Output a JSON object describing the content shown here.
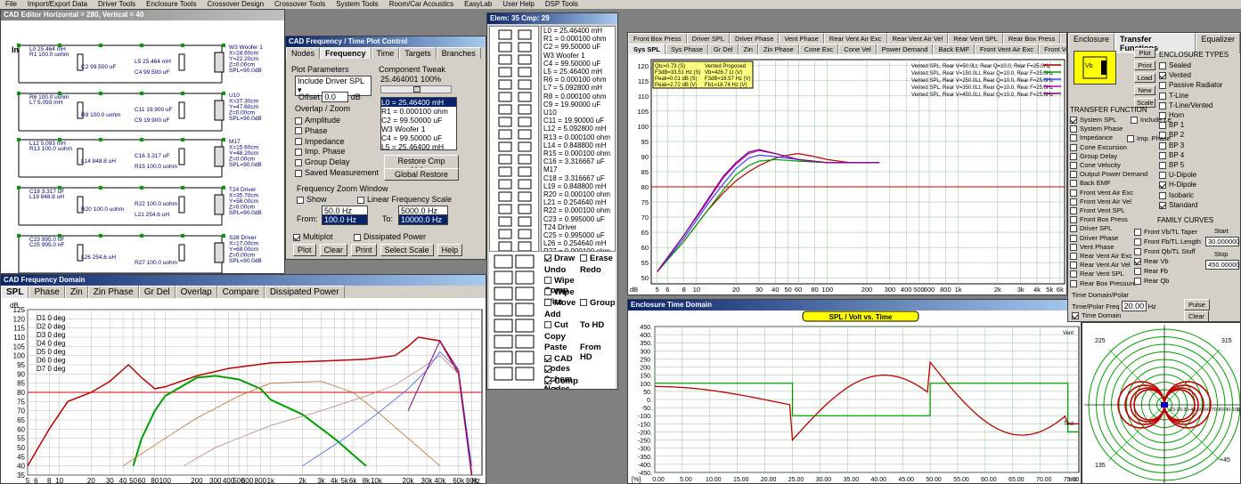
{
  "menu": [
    "File",
    "Import/Export Data",
    "Driver Tools",
    "Enclosure Tools",
    "Crossover Design",
    "Crossover Tools",
    "System Tools",
    "Room/Car Acoustics",
    "EasyLab",
    "User Help",
    "DSP Tools"
  ],
  "cad_editor": {
    "title": "CAD Editor  Horizontal = 280, Vertical = 40",
    "labels": [
      "L0 25.464 mH",
      "R1 100.0 uohm",
      "C2 99.500 uF",
      "C4 99.500 uF",
      "L5 25.464 mH",
      "R6 100.0 uohm",
      "L7 5.093 mH",
      "R8 100.0 uohm",
      "C9 19.900 uF",
      "C11 19.900 uF",
      "L12 5.093 mH",
      "R13 100.0 uohm",
      "L14 848.8 uH",
      "R15 100.0 uohm",
      "C16 3.317 uF",
      "C18 3.317 uF",
      "L19 848.8 uH",
      "R20 100.0 uohm",
      "L21 254.6 uH",
      "R22 100.0 uohm",
      "C23 995.0 nF",
      "C25 995.0 nF",
      "L26 254.6 uH",
      "R27 100.0 uohm"
    ],
    "drivers": [
      {
        "name": "W3 Woofer 1",
        "x": "X=18.60cm",
        "y": "Y=22.20cm",
        "z": "Z=0.00cm",
        "spl": "SPL=90.0dB"
      },
      {
        "name": "U10",
        "x": "X=37.30cm",
        "y": "Y=47.60cm",
        "z": "Z=0.00cm",
        "spl": "SPL=90.0dB"
      },
      {
        "name": "M17",
        "x": "X=15.60cm",
        "y": "Y=48.20cm",
        "z": "Z=0.00cm",
        "spl": "SPL=90.0dB"
      },
      {
        "name": "T24 Driver",
        "x": "X=35.70cm",
        "y": "Y=58.00cm",
        "z": "Z=0.00cm",
        "spl": "SPL=90.0dB"
      },
      {
        "name": "S28 Driver",
        "x": "X=17.00cm",
        "y": "Y=68.00cm",
        "z": "Z=0.00cm",
        "spl": "SPL=90.0dB"
      }
    ],
    "in_label": "In"
  },
  "plot_control": {
    "title": "CAD Frequency / Time Plot Control",
    "tabs": [
      "Nodes",
      "Frequency",
      "Time",
      "Targets",
      "Branches"
    ],
    "active_tab": "Frequency",
    "plot_params": "Plot Parameters",
    "dropdown": "Include Driver SPL",
    "offset_label": "Offset",
    "offset": "0.0",
    "offset_unit": "dB",
    "overlap": "Overlap / Zoom",
    "checks": [
      "Amplitude",
      "Phase",
      "Impedance",
      "Imp. Phase",
      "Group Delay",
      "Saved Measurement"
    ],
    "tweak_title": "Component Tweak",
    "tweak_val": "25.464001",
    "tweak_pct": "100%",
    "tweak_list": [
      "L0 = 25.46400 mH",
      "R1 = 0.000100 ohm",
      "C2 = 99.50000 uF",
      "W3 Woofer 1",
      "C4 = 99.50000 uF",
      "L5 = 25.46400 mH"
    ],
    "restore": "Restore Cmp Value",
    "global": "Global Restore",
    "zoom_title": "Frequency Zoom Window",
    "show": "Show",
    "linear": "Linear Frequency Scale",
    "from_label": "From:",
    "from1": "50.0 Hz",
    "from2": "100.0 Hz",
    "to_label": "To:",
    "to1": "5000.0 Hz",
    "to2": "10000.0 Hz",
    "multiplot": "Multiplot",
    "dissipated": "Dissipated Power",
    "buttons": [
      "Plot",
      "Clear",
      "Print",
      "Select Scale",
      "Help"
    ]
  },
  "elem_list": {
    "title": "Elem: 35 Cmp: 29",
    "items": [
      "L0 = 25.46400 mH",
      "R1 = 0.000100 ohm",
      "C2 = 99.50000 uF",
      "W3 Woofer 1",
      "C4 = 99.50000 uF",
      "L5 = 25.46400 mH",
      "R6 = 0.000100 ohm",
      "L7 = 5.092800 mH",
      "R8 = 0.000100 ohm",
      "C9 = 19.90000 uF",
      "U10",
      "C11 = 19.90000 uF",
      "L12 = 5.092800 mH",
      "R13 = 0.000100 ohm",
      "L14 = 0.848800 mH",
      "R15 = 0.000100 ohm",
      "C16 = 3.316667 uF",
      "M17",
      "C18 = 3.316667 uF",
      "L19 = 0.848800 mH",
      "R20 = 0.000100 ohm",
      "L21 = 0.254640 mH",
      "R22 = 0.000100 ohm",
      "C23 = 0.995000 uF",
      "T24 Driver",
      "C25 = 0.995000 uF",
      "L26 = 0.254640 mH",
      "R27 = 0.000100 ohm",
      "S28 Driver"
    ],
    "tools": [
      [
        "Draw",
        "Erase"
      ],
      [
        "Undo",
        "Redo"
      ],
      [
        "Wipe Comp",
        ""
      ],
      [
        "Wipe Wire",
        ""
      ],
      [
        "Move",
        "Group"
      ],
      [
        "Add",
        ""
      ],
      [
        "Cut",
        "To HD"
      ],
      [
        "Copy",
        ""
      ],
      [
        "Paste",
        "From HD"
      ],
      [
        "CAD Nodes",
        ""
      ],
      [
        "Schem Nodes",
        ""
      ],
      [
        "Comp Values",
        ""
      ]
    ]
  },
  "freq_domain": {
    "title": "CAD Frequency Domain",
    "tabs": [
      "SPL",
      "Phase",
      "Zin",
      "Zin Phase",
      "Gr Del",
      "Overlap",
      "Compare",
      "Dissipated Power"
    ],
    "unit": "dB",
    "legend": [
      "D1 0 deg",
      "D2 0 deg",
      "D3 0 deg",
      "D4 0 deg",
      "D5 0 deg",
      "D6 0 deg",
      "D7 0 deg"
    ],
    "yticks": [
      "125",
      "120",
      "115",
      "110",
      "105",
      "100",
      "95",
      "90",
      "85",
      "80",
      "75",
      "70",
      "65",
      "60",
      "55",
      "50",
      "45",
      "40",
      "35"
    ],
    "xticks": [
      "5",
      "6",
      "8",
      "10",
      "20",
      "30",
      "40",
      "50",
      "60",
      "80",
      "100",
      "200",
      "300",
      "400",
      "500",
      "600",
      "800",
      "1k",
      "2k",
      "3k",
      "4k",
      "5k",
      "6k",
      "8k",
      "10k",
      "20k",
      "30k",
      "40k",
      "60k",
      "80k",
      "Hz"
    ],
    "colors": {
      "red": "#c00000",
      "green": "#00a000",
      "blue": "#4060ff",
      "orange": "#c07030",
      "purple": "#800080"
    }
  },
  "enclosure_plot": {
    "tabs1": [
      "Front Box Press",
      "Driver SPL",
      "Driver Phase",
      "Vent Phase",
      "Rear Vent Air Exc",
      "Rear Vent Air Vel",
      "Rear Vent SPL",
      "Rear Box Press",
      "EQ",
      "Front"
    ],
    "tabs2": [
      "Sys SPL",
      "Sys Phase",
      "Gr Del",
      "Zin",
      "Zin Phase",
      "Cone Exc",
      "Cone Vel",
      "Power Demand",
      "Back EMF",
      "Front Vent Air Exc",
      "Front Vent Air Vel",
      "Front"
    ],
    "info_left": [
      "Qtc=0.73 (S)",
      "F3dB=33.51 Hz (S)",
      "Peak=0.01 dB (S)",
      "Peak=2.72 dB (V)"
    ],
    "info_right": [
      "Vented Proposed",
      "Vb=426.7 Lt (V)",
      "F3dB=16.57 Hz (V)",
      "Fb1=18.74 Hz (V)"
    ],
    "legend": [
      "Vented SPL, Rear V=50.0Lt, Rear Q=10.0, Rear F=25.0Hz",
      "Vented SPL, Rear V=150.0Lt, Rear Q=10.0, Rear F=25.0Hz",
      "Vented SPL, Rear V=250.0Lt, Rear Q=10.0, Rear F=25.0Hz",
      "Vented SPL, Rear V=350.0Lt, Rear Q=10.0, Rear F=25.0Hz",
      "Vented SPL, Rear V=450.0Lt, Rear Q=10.0, Rear F=25.0Hz"
    ],
    "legend_colors": [
      "#c00000",
      "#00a000",
      "#4040ff",
      "#c000c0",
      "#800080"
    ],
    "yticks": [
      "120",
      "115",
      "110",
      "105",
      "100",
      "95",
      "90",
      "85",
      "80",
      "75",
      "70",
      "65",
      "60",
      "55",
      "50"
    ],
    "xticks": [
      "5",
      "6",
      "8",
      "10",
      "20",
      "30",
      "40",
      "50",
      "60",
      "80",
      "100",
      "200",
      "300",
      "400",
      "500",
      "600",
      "800",
      "1k",
      "2k",
      "3k",
      "4k",
      "5k",
      "6k"
    ],
    "unit": "dB"
  },
  "time_domain": {
    "title": "Enclosure Time Domain",
    "plot_title": "SPL / Volt vs. Time",
    "yticks": [
      "450.",
      "400.",
      "350.",
      "300.",
      "250.",
      "200.",
      "150.",
      "100.",
      "50.",
      "0.",
      "-50.",
      "-100.",
      "-150.",
      "-200.",
      "-250.",
      "-300.",
      "-350.",
      "-400.",
      "-450."
    ],
    "xticks": [
      "0.00",
      "5.00",
      "10.00",
      "15.00",
      "20.00",
      "25.00",
      "30.00",
      "35.00",
      "40.00",
      "45.00",
      "50.00",
      "55.00",
      "60.00",
      "65.00",
      "70.00",
      "75.00"
    ],
    "x_unit": "ms",
    "y_unit": "[%]",
    "vent_label": "Vent",
    "test_label": "Test"
  },
  "enclosure_panel": {
    "tabs": [
      "Enclosure",
      "Transfer Functions",
      "Equalizer"
    ],
    "active": "Transfer Functions",
    "buttons": [
      "Plot",
      "Print",
      "Load",
      "New",
      "Scale"
    ],
    "types_title": "ENCLOSURE TYPES",
    "types": [
      [
        "Sealed",
        false
      ],
      [
        "Vented",
        true
      ],
      [
        "Passive Radiator",
        false
      ],
      [
        "T-Line",
        false
      ],
      [
        "T-Line/Vented",
        false
      ],
      [
        "Horn",
        false
      ],
      [
        "BP 1",
        false
      ],
      [
        "BP 2",
        false
      ],
      [
        "BP 3",
        false
      ],
      [
        "BP 4",
        false
      ],
      [
        "BP 5",
        false
      ],
      [
        "U-Dipole",
        false
      ],
      [
        "H-Dipole",
        true
      ],
      [
        "Isobaric",
        false
      ],
      [
        "Standard",
        true
      ]
    ],
    "tf_title": "TRANSFER FUNCTION",
    "tf": [
      [
        "System SPL",
        true
      ],
      [
        "System Phase",
        false
      ],
      [
        "Impedance",
        false
      ],
      [
        "Cone Excursion",
        false
      ],
      [
        "Group Delay",
        false
      ],
      [
        "Cone Velocity",
        false
      ],
      [
        "Output Power Demand",
        false
      ],
      [
        "Back EMF",
        false
      ],
      [
        "Front Vent Air Exc",
        false
      ],
      [
        "Front Vent Air Vel",
        false
      ],
      [
        "Front Vent SPL",
        false
      ],
      [
        "Front Box Press",
        false
      ],
      [
        "Driver SPL",
        false
      ],
      [
        "Driver Phase",
        false
      ],
      [
        "Vent Phase",
        false
      ],
      [
        "Rear Vent Air Exc",
        false
      ],
      [
        "Rear Vent Air Vel",
        false
      ],
      [
        "Rear Vent SPL",
        false
      ],
      [
        "Rear Box Pressure",
        false
      ]
    ],
    "include_le": "Include Le",
    "imp_phase": "Imp. Phase",
    "family_title": "FAMILY CURVES",
    "family": [
      [
        "Front Vb/TL Taper",
        false
      ],
      [
        "Front Fb/TL Length",
        false
      ],
      [
        "Front Qb/TL Stuff",
        false
      ],
      [
        "Rear Vb",
        true
      ],
      [
        "Rear Fb",
        false
      ],
      [
        "Rear Qb",
        false
      ]
    ],
    "start_label": "Start",
    "start": "30.000000",
    "stop_label": "Stop",
    "stop": "450.000000",
    "time_title": "Time Domain/Polar",
    "tp_label": "Time/Polar Freq",
    "tp_val": "20.00",
    "tp_unit": "Hz",
    "time_domain_chk": "Time Domain",
    "pulse": "Pulse",
    "clear": "Clear"
  },
  "polar": {
    "labels": [
      "225",
      "315",
      "135",
      "+45"
    ],
    "ring_labels": [
      "-10",
      "-20",
      "-30",
      "-40",
      "-50",
      "-60",
      "-70",
      "-80",
      "-90",
      "-100",
      "[dB]"
    ]
  }
}
